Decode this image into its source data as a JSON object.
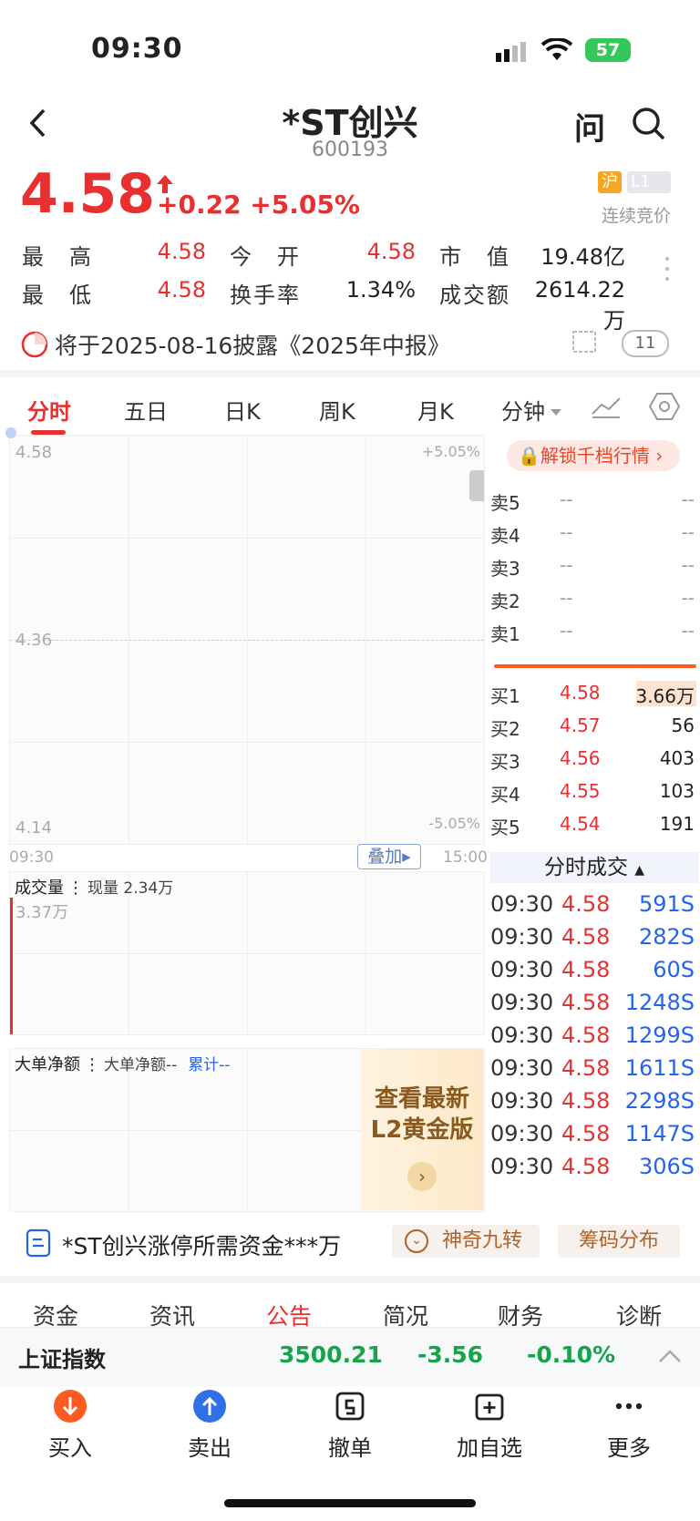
{
  "status": {
    "time": "09:30",
    "battery": "57"
  },
  "header": {
    "name": "*ST创兴",
    "code": "600193",
    "ask_label": "问"
  },
  "quote": {
    "price": "4.58",
    "change": "+0.22 +5.05%",
    "market_badge": "沪",
    "level_badge": "L1",
    "trade_mode": "连续竞价",
    "stats": [
      {
        "label": "最　高",
        "value": "4.58"
      },
      {
        "label": "今　开",
        "value": "4.58"
      },
      {
        "label": "市　值",
        "value": "19.48亿"
      },
      {
        "label": "最　低",
        "value": "4.58"
      },
      {
        "label": "换手率",
        "value": "1.34%"
      },
      {
        "label": "成交额",
        "value": "2614.22万"
      }
    ]
  },
  "notice": {
    "text": "将于2025-08-16披露《2025年中报》",
    "count": "11"
  },
  "tabs": [
    "分时",
    "五日",
    "日K",
    "周K",
    "月K",
    "分钟"
  ],
  "chart": {
    "y_top": "4.58",
    "y_mid": "4.36",
    "y_bottom": "4.14",
    "pct_top": "+5.05%",
    "pct_bottom": "-5.05%",
    "t_start": "09:30",
    "t_end": "15:00",
    "overlay_label": "叠加"
  },
  "volume": {
    "title": "成交量",
    "current": "现量 2.34万",
    "max": "3.37万"
  },
  "bigorder": {
    "title": "大单净额",
    "detail": "大单净额--",
    "cumulative": "累计--"
  },
  "promo": {
    "line1": "查看最新",
    "line2": "L2黄金版"
  },
  "unlock_label": "解锁千档行情",
  "sells": [
    {
      "label": "卖5",
      "price": "--",
      "vol": "--"
    },
    {
      "label": "卖4",
      "price": "--",
      "vol": "--"
    },
    {
      "label": "卖3",
      "price": "--",
      "vol": "--"
    },
    {
      "label": "卖2",
      "price": "--",
      "vol": "--"
    },
    {
      "label": "卖1",
      "price": "--",
      "vol": "--"
    }
  ],
  "buys": [
    {
      "label": "买1",
      "price": "4.58",
      "vol": "3.66万"
    },
    {
      "label": "买2",
      "price": "4.57",
      "vol": "56"
    },
    {
      "label": "买3",
      "price": "4.56",
      "vol": "403"
    },
    {
      "label": "买4",
      "price": "4.55",
      "vol": "103"
    },
    {
      "label": "买5",
      "price": "4.54",
      "vol": "191"
    }
  ],
  "ticks_title": "分时成交",
  "ticks": [
    {
      "time": "09:30",
      "price": "4.58",
      "vol": "591S"
    },
    {
      "time": "09:30",
      "price": "4.58",
      "vol": "282S"
    },
    {
      "time": "09:30",
      "price": "4.58",
      "vol": "60S"
    },
    {
      "time": "09:30",
      "price": "4.58",
      "vol": "1248S"
    },
    {
      "time": "09:30",
      "price": "4.58",
      "vol": "1299S"
    },
    {
      "time": "09:30",
      "price": "4.58",
      "vol": "1611S"
    },
    {
      "time": "09:30",
      "price": "4.58",
      "vol": "2298S"
    },
    {
      "time": "09:30",
      "price": "4.58",
      "vol": "1147S"
    },
    {
      "time": "09:30",
      "price": "4.58",
      "vol": "306S"
    }
  ],
  "feature_bar": {
    "capital_text": "*ST创兴涨停所需资金***万",
    "nine": "神奇九转",
    "chips": "筹码分布"
  },
  "info_tabs": [
    "资金",
    "资讯",
    "公告",
    "简况",
    "财务",
    "诊断"
  ],
  "index": {
    "name": "上证指数",
    "value": "3500.21",
    "change": "-3.56",
    "pct": "-0.10%"
  },
  "nav": [
    "买入",
    "卖出",
    "撤单",
    "加自选",
    "更多"
  ],
  "colors": {
    "up": "#e93030",
    "down": "#16a34a",
    "accent": "#ff5a1f",
    "blue": "#2563eb"
  }
}
